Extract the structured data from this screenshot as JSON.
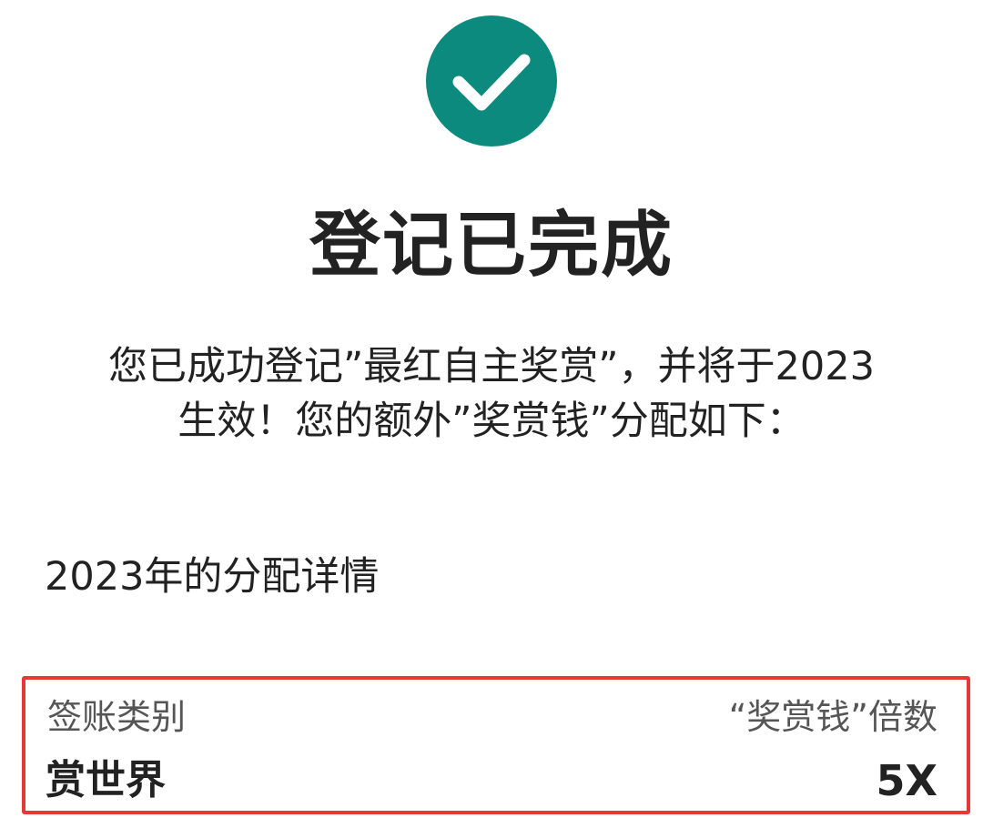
{
  "status": {
    "icon": "checkmark-circle-icon",
    "icon_color": "#0d8a7e"
  },
  "title": "登记已完成",
  "message": {
    "line1": "您已成功登记”最红自主奖赏”，并将于2023",
    "line2": "生效！您的额外”奖赏钱”分配如下："
  },
  "allocation": {
    "section_title": "2023年的分配详情",
    "highlight_color": "#e53935",
    "headers": {
      "category": "签账类别",
      "multiplier": "“奖赏钱”倍数"
    },
    "rows": [
      {
        "category": "赏世界",
        "multiplier": "5X"
      }
    ]
  }
}
